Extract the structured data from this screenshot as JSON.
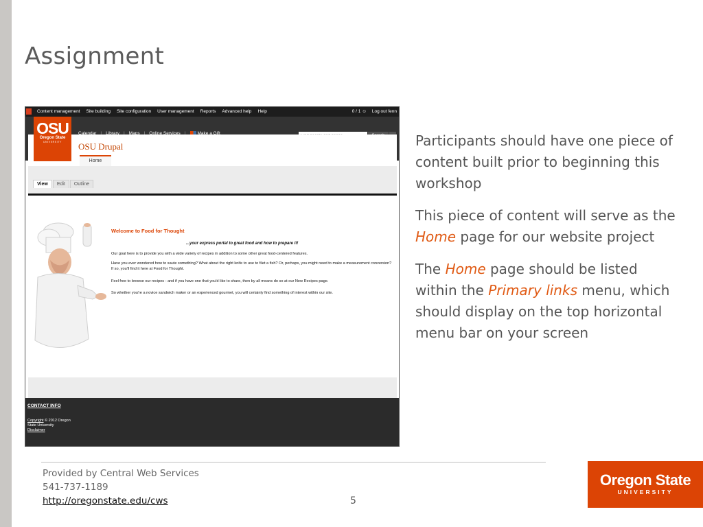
{
  "slide": {
    "title": "Assignment",
    "bullets": [
      "Participants should have one piece of content built prior to beginning this workshop",
      {
        "before": "This piece of content will serve as the ",
        "highlight": "Home",
        "after": " page for our website project"
      },
      {
        "p1": "The ",
        "h1": "Home",
        "p2": " page should be listed within the ",
        "h2": "Primary links",
        "p3": " menu, which should display on the top horizontal menu bar on your screen"
      }
    ],
    "credit": {
      "line1": "Provided by Central Web Services",
      "phone": "541-737-1189",
      "url": "http://oregonstate.edu/cws"
    },
    "page_number": "5",
    "logo": {
      "name": "Oregon State",
      "sub": "UNIVERSITY"
    }
  },
  "screenshot": {
    "admin_menu": [
      "Content management",
      "Site building",
      "Site configuration",
      "User management",
      "Reports",
      "Advanced help",
      "Help"
    ],
    "user_count": "0 / 1",
    "logout": "Log out fenn",
    "logo": {
      "osu": "OSU",
      "oregon_state": "Oregon State",
      "university": "UNIVERSITY"
    },
    "top_nav": [
      "Calendar",
      "Library",
      "Maps",
      "Online Services",
      "Make a Gift"
    ],
    "search": {
      "placeholder": "Find people and pages",
      "button": "Search"
    },
    "site_name": "OSU Drupal",
    "primary_link": "Home",
    "tabs": [
      "View",
      "Edit",
      "Outline"
    ],
    "content": {
      "heading": "Welcome to Food for Thought",
      "tagline": "...your express portal to great food and how to prepare it!",
      "paragraphs": [
        "Our goal here is to provide you with a wide variety of recipes in addition to some other great food-centered features.",
        "Have you ever wondered how to saute something?  What about the right knife to use to filet a fish?  Or, perhaps, you might need to make a measurement conversion?  If so, you'll find it here at Food for Thought.",
        "Feel free to browse our recipes - and if you have one that you'd like to share, then by all means do so at our New Recipes page.",
        "So whether you're a novice sandwich maker or an experienced gourmet, you will certainly find something of interest within our site."
      ]
    },
    "footer": {
      "contact": "CONTACT INFO",
      "copyright_link": "Copyright",
      "copyright_text": " ©  2012 Oregon",
      "copyright_line2": "State University",
      "disclaimer": "Disclaimer"
    }
  },
  "colors": {
    "accent": "#e05a14",
    "osu_orange": "#dc4405",
    "header": "#333333",
    "footer": "#2b2b2b",
    "left_bar": "#c9c7c4"
  },
  "icons": [
    "gift-icon",
    "user-icon",
    "admin-icon",
    "chevron-down-icon"
  ]
}
